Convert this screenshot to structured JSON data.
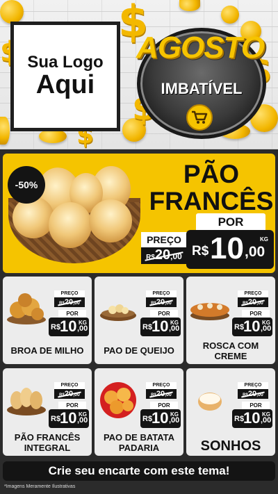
{
  "header": {
    "logo_line1": "Sua Logo",
    "logo_line2": "Aqui",
    "campaign_title": "AGOSTO",
    "campaign_subtitle": "IMBATÍVEL",
    "coin_symbol": "$",
    "cart_icon": "shopping-cart-icon"
  },
  "featured": {
    "discount": "-50%",
    "title_line1": "PÃO",
    "title_line2": "FRANCÊS",
    "preco_label": "PREÇO",
    "old_currency": "R$",
    "old_integer": "20",
    "old_cents": ",00",
    "por_label": "POR",
    "currency": "R$",
    "integer": "10",
    "cents": ",00",
    "unit": "KG"
  },
  "products": [
    {
      "name_line1": "BROA DE MILHO",
      "name_line2": "",
      "preco_label": "PREÇO",
      "old_currency": "R$",
      "old_integer": "20",
      "old_cents": ",00",
      "por_label": "POR",
      "currency": "R$",
      "integer": "10",
      "cents": ",00",
      "unit": "KG"
    },
    {
      "name_line1": "PAO DE QUEIJO",
      "name_line2": "",
      "preco_label": "PREÇO",
      "old_currency": "R$",
      "old_integer": "20",
      "old_cents": ",00",
      "por_label": "POR",
      "currency": "R$",
      "integer": "10",
      "cents": ",00",
      "unit": "KG"
    },
    {
      "name_line1": "ROSCA COM",
      "name_line2": "CREME",
      "preco_label": "PREÇO",
      "old_currency": "R$",
      "old_integer": "20",
      "old_cents": ",00",
      "por_label": "POR",
      "currency": "R$",
      "integer": "10",
      "cents": ",00",
      "unit": "KG"
    },
    {
      "name_line1": "PÃO FRANCÊS",
      "name_line2": "INTEGRAL",
      "preco_label": "PREÇO",
      "old_currency": "R$",
      "old_integer": "20",
      "old_cents": ",00",
      "por_label": "POR",
      "currency": "R$",
      "integer": "10",
      "cents": ",00",
      "unit": "KG"
    },
    {
      "name_line1": "PAO DE BATATA",
      "name_line2": "PADARIA",
      "preco_label": "PREÇO",
      "old_currency": "R$",
      "old_integer": "20",
      "old_cents": ",00",
      "por_label": "POR",
      "currency": "R$",
      "integer": "10",
      "cents": ",00",
      "unit": "KG"
    },
    {
      "name_line1": "SONHOS",
      "name_line2": "",
      "preco_label": "PREÇO",
      "old_currency": "R$",
      "old_integer": "20",
      "old_cents": ",00",
      "por_label": "POR",
      "currency": "R$",
      "integer": "10",
      "cents": ",00",
      "unit": "KG"
    }
  ],
  "cta": "Crie seu encarte com este tema!",
  "disclaimer": "*Imagens Meramente Ilustrativas",
  "colors": {
    "accent": "#f5c400",
    "dark": "#141414",
    "card": "#ececec",
    "background": "#2b2b2b"
  }
}
